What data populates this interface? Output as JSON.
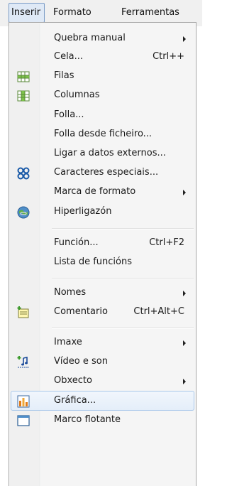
{
  "menubar": {
    "inserir": "Inserir",
    "formato": "Formato",
    "ferramentas": "Ferramentas"
  },
  "menu": {
    "quebra_manual": "Quebra manual",
    "cela": "Cela...",
    "cela_shortcut": "Ctrl++",
    "filas": "Filas",
    "columnas": "Columnas",
    "folla": "Folla...",
    "folla_ficheiro": "Folla desde ficheiro...",
    "ligar_datos": "Ligar a datos externos...",
    "caracteres": "Caracteres especiais...",
    "marca_formato": "Marca de formato",
    "hiperligazon": "Hiperligazón",
    "funcion": "Función...",
    "funcion_shortcut": "Ctrl+F2",
    "lista_funcions": "Lista de funcións",
    "nomes": "Nomes",
    "comentario": "Comentario",
    "comentario_shortcut": "Ctrl+Alt+C",
    "imaxe": "Imaxe",
    "video_son": "Vídeo e son",
    "obxecto": "Obxecto",
    "grafica": "Gráfica...",
    "marco_flotante": "Marco flotante"
  },
  "colors": {
    "highlight_border": "#a8c7ea",
    "highlight_bg": "#e4eef9",
    "menu_bg": "#f5f5f5"
  }
}
